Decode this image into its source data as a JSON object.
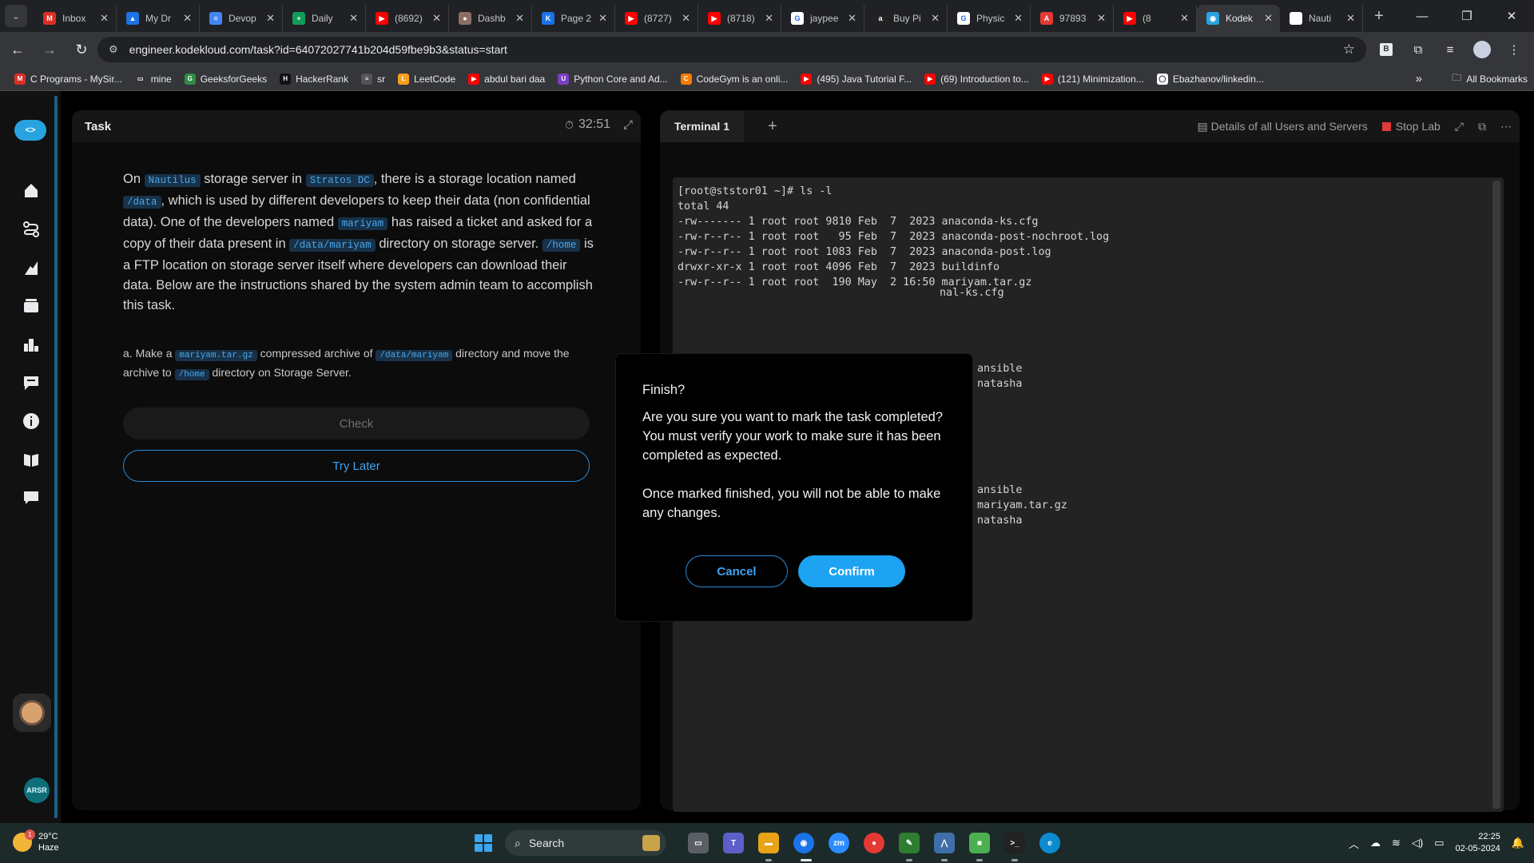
{
  "browser": {
    "tabs": [
      {
        "label": "Inbox",
        "fav_color": "#d93025",
        "fav_glyph": "M"
      },
      {
        "label": "My Dr",
        "fav_color": "#1a73e8",
        "fav_glyph": "▲"
      },
      {
        "label": "Devop",
        "fav_color": "#4285f4",
        "fav_glyph": "≡"
      },
      {
        "label": "Daily",
        "fav_color": "#0f9d58",
        "fav_glyph": "+"
      },
      {
        "label": "(8692)",
        "fav_color": "#ff0000",
        "fav_glyph": "▶"
      },
      {
        "label": "Dashb",
        "fav_color": "#8d6e63",
        "fav_glyph": "●"
      },
      {
        "label": "Page 2",
        "fav_color": "#1a73e8",
        "fav_glyph": "K"
      },
      {
        "label": "(8727)",
        "fav_color": "#ff0000",
        "fav_glyph": "▶"
      },
      {
        "label": "(8718)",
        "fav_color": "#ff0000",
        "fav_glyph": "▶"
      },
      {
        "label": "jaypee",
        "fav_color": "#ffffff",
        "fav_glyph": "G"
      },
      {
        "label": "Buy Pi",
        "fav_color": "#222222",
        "fav_glyph": "a"
      },
      {
        "label": "Physic",
        "fav_color": "#ffffff",
        "fav_glyph": "G"
      },
      {
        "label": "97893",
        "fav_color": "#e53935",
        "fav_glyph": "A"
      },
      {
        "label": "(8",
        "fav_color": "#ff0000",
        "fav_glyph": "▶"
      },
      {
        "label": "Kodek",
        "fav_color": "#29a3e0",
        "fav_glyph": "◉"
      },
      {
        "label": "Nauti",
        "fav_color": "#ffffff",
        "fav_glyph": ""
      }
    ],
    "active_tab_index": 14,
    "url": "engineer.kodekloud.com/task?id=64072027741b204d59fbe9b3&status=start",
    "bookmarks": [
      {
        "label": "C Programs - MySir...",
        "fav_color": "#d93025",
        "fav_glyph": "M"
      },
      {
        "label": "mine",
        "fav_color": "#35363a",
        "fav_glyph": "▭"
      },
      {
        "label": "GeeksforGeeks",
        "fav_color": "#2f8d46",
        "fav_glyph": "G"
      },
      {
        "label": "HackerRank",
        "fav_color": "#111111",
        "fav_glyph": "H"
      },
      {
        "label": "sr",
        "fav_color": "#555555",
        "fav_glyph": "≡"
      },
      {
        "label": "LeetCode",
        "fav_color": "#f89f1b",
        "fav_glyph": "L"
      },
      {
        "label": "abdul bari daa",
        "fav_color": "#ff0000",
        "fav_glyph": "▶"
      },
      {
        "label": "Python Core and Ad...",
        "fav_color": "#7b3fc4",
        "fav_glyph": "U"
      },
      {
        "label": "CodeGym is an onli...",
        "fav_color": "#f57c00",
        "fav_glyph": "C"
      },
      {
        "label": "(495) Java Tutorial F...",
        "fav_color": "#ff0000",
        "fav_glyph": "▶"
      },
      {
        "label": "(69) Introduction to...",
        "fav_color": "#ff0000",
        "fav_glyph": "▶"
      },
      {
        "label": "(121) Minimization...",
        "fav_color": "#ff0000",
        "fav_glyph": "▶"
      },
      {
        "label": "Ebazhanov/linkedin...",
        "fav_color": "#ffffff",
        "fav_glyph": "◯"
      }
    ],
    "all_bookmarks_label": "All Bookmarks",
    "more_label": "»"
  },
  "sidebar": {
    "icons": [
      "home-icon",
      "routes-icon",
      "skills-icon",
      "courses-icon",
      "leaderboard-icon",
      "feedback-icon",
      "info-icon",
      "docs-icon",
      "chat-icon"
    ],
    "user_initials": "ARSR"
  },
  "task": {
    "header": "Task",
    "timer": "32:51",
    "description": {
      "p1": "On ",
      "c1": "Nautilus",
      "p2": " storage server in ",
      "c2": "Stratos DC",
      "p3": ", there is a storage location named ",
      "c3": "/data",
      "p4": ", which is used by different developers to keep their data (non confidential data). One of the developers named ",
      "c4": "mariyam",
      "p5": " has raised a ticket and asked for a copy of their data present in ",
      "c5": "/data/mariyam",
      "p6": " directory on storage server. ",
      "c6": "/home",
      "p7": " is a FTP location on storage server itself where developers can download their data. Below are the instructions shared by the system admin team to accomplish this task."
    },
    "instruction": {
      "p1": "a. Make a ",
      "c1": "mariyam.tar.gz",
      "p2": " compressed archive of ",
      "c2": "/data/mariyam",
      "p3": " directory and move the archive to ",
      "c3": "/home",
      "p4": " directory on Storage Server."
    },
    "check_label": "Check",
    "try_later_label": "Try Later"
  },
  "terminal": {
    "tab_label": "Terminal 1",
    "add_label": "+",
    "details_label": "Details of all Users and Servers",
    "stop_label": "Stop Lab",
    "lines": [
      "[root@ststor01 ~]# ls -l",
      "total 44",
      "-rw------- 1 root root 9810 Feb  7  2023 anaconda-ks.cfg",
      "-rw-r--r-- 1 root root   95 Feb  7  2023 anaconda-post-nochroot.log",
      "-rw-r--r-- 1 root root 1083 Feb  7  2023 anaconda-post.log",
      "drwxr-xr-x 1 root root 4096 Feb  7  2023 buildinfo",
      "-rw-r--r-- 1 root root  190 May  2 16:50 mariyam.tar.gz"
    ],
    "fragments": [
      "nal-ks.cfg",
      "ansible",
      "natasha",
      "ansible",
      "mariyam.tar.gz",
      "natasha"
    ]
  },
  "dialog": {
    "title": "Finish?",
    "text1": "Are you sure you want to mark the task completed? You must verify your work to make sure it has been completed as expected.",
    "text2": "Once marked finished, you will not be able to make any changes.",
    "cancel_label": "Cancel",
    "confirm_label": "Confirm"
  },
  "taskbar": {
    "temperature": "29°C",
    "weather": "Haze",
    "weather_badge": "1",
    "search_label": "Search",
    "time": "22:25",
    "date": "02-05-2024"
  }
}
